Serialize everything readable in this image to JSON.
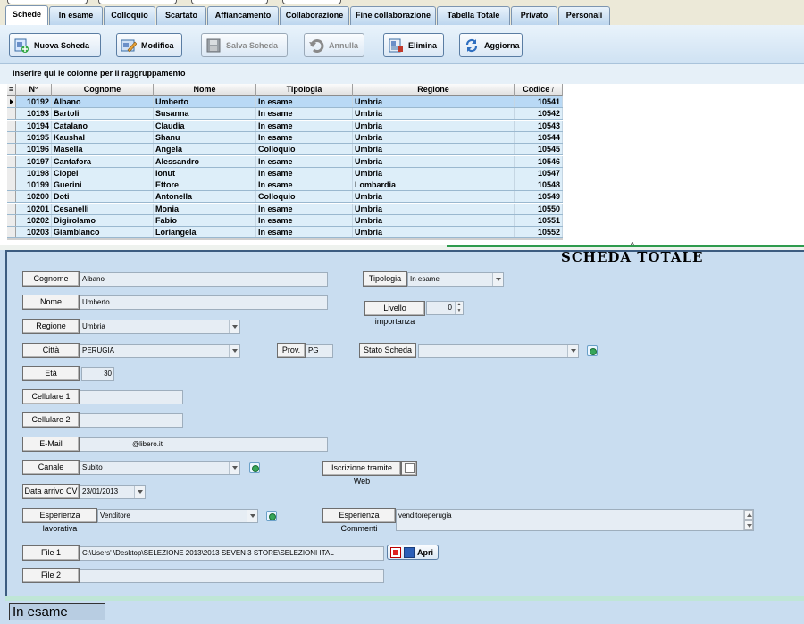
{
  "tabs": [
    {
      "label": "Schede",
      "active": true
    },
    {
      "label": "In esame"
    },
    {
      "label": "Colloquio"
    },
    {
      "label": "Scartato"
    },
    {
      "label": "Affiancamento"
    },
    {
      "label": "Collaborazione"
    },
    {
      "label": "Fine collaborazione"
    },
    {
      "label": "Tabella Totale"
    },
    {
      "label": "Privato"
    },
    {
      "label": "Personali"
    }
  ],
  "toolbar": {
    "new_label": "Nuova Scheda",
    "edit_label": "Modifica",
    "save_label": "Salva Scheda",
    "cancel_label": "Annulla",
    "delete_label": "Elimina",
    "refresh_label": "Aggiorna"
  },
  "group_hint": "Inserire qui le colonne per il raggruppamento",
  "grid": {
    "columns": [
      "N°",
      "Cognome",
      "Nome",
      "Tipologia",
      "Regione",
      "Codice"
    ],
    "rows": [
      [
        "10192",
        "Albano",
        "Umberto",
        "In esame",
        "Umbria",
        "10541"
      ],
      [
        "10193",
        "Bartoli",
        "Susanna",
        "In esame",
        "Umbria",
        "10542"
      ],
      [
        "10194",
        "Catalano",
        "Claudia",
        "In esame",
        "Umbria",
        "10543"
      ],
      [
        "10195",
        "Kaushal",
        "Shanu",
        "In esame",
        "Umbria",
        "10544"
      ],
      [
        "10196",
        "Masella",
        "Angela",
        "Colloquio",
        "Umbria",
        "10545"
      ],
      [
        "10197",
        "Cantafora",
        "Alessandro",
        "In esame",
        "Umbria",
        "10546"
      ],
      [
        "10198",
        "Ciopei",
        "Ionut",
        "In esame",
        "Umbria",
        "10547"
      ],
      [
        "10199",
        "Guerini",
        "Ettore",
        "In esame",
        "Lombardia",
        "10548"
      ],
      [
        "10200",
        "Doti",
        "Antonella",
        "Colloquio",
        "Umbria",
        "10549"
      ],
      [
        "10201",
        "Cesanelli",
        "Monia",
        "In esame",
        "Umbria",
        "10550"
      ],
      [
        "10202",
        "Digirolamo",
        "Fabio",
        "In esame",
        "Umbria",
        "10551"
      ],
      [
        "10203",
        "Giamblanco",
        "Loriangela",
        "In esame",
        "Umbria",
        "10552"
      ]
    ]
  },
  "form": {
    "title": "SCHEDA TOTALE",
    "cognome_label": "Cognome",
    "cognome_value": "Albano",
    "nome_label": "Nome",
    "nome_value": "Umberto",
    "regione_label": "Regione",
    "regione_value": "Umbria",
    "citta_label": "Città",
    "citta_value": "PERUGIA",
    "prov_label": "Prov.",
    "prov_value": "PG",
    "eta_label": "Età",
    "eta_value": "30",
    "cell1_label": "Cellulare 1",
    "cell1_value": "",
    "cell2_label": "Cellulare 2",
    "cell2_value": "",
    "email_label": "E-Mail",
    "email_value": "@libero.it",
    "canale_label": "Canale",
    "canale_value": "Subito",
    "data_label": "Data arrivo CV",
    "data_value": "23/01/2013",
    "esperienza_label": "Esperienza lavorativa",
    "esperienza_value": "Venditore",
    "file1_label": "File 1",
    "file1_value": "C:\\Users'                    \\Desktop\\SELEZIONE 2013\\2013 SEVEN 3 STORE\\SELEZIONI ITAL",
    "file2_label": "File 2",
    "file2_value": "",
    "apri_label": "Apri",
    "tipologia_label": "Tipologia",
    "tipologia_value": "In esame",
    "livello_label": "Livello importanza",
    "livello_value": "0",
    "stato_label": "Stato Scheda",
    "stato_value": "",
    "iscrizione_label": "Iscrizione tramite Web",
    "commenti_label": "Esperienza Commenti",
    "commenti_value": "venditoreperugia"
  },
  "status": "In esame",
  "colors": {
    "accent": "#2e9b4e",
    "panel": "#c9ddf0"
  }
}
